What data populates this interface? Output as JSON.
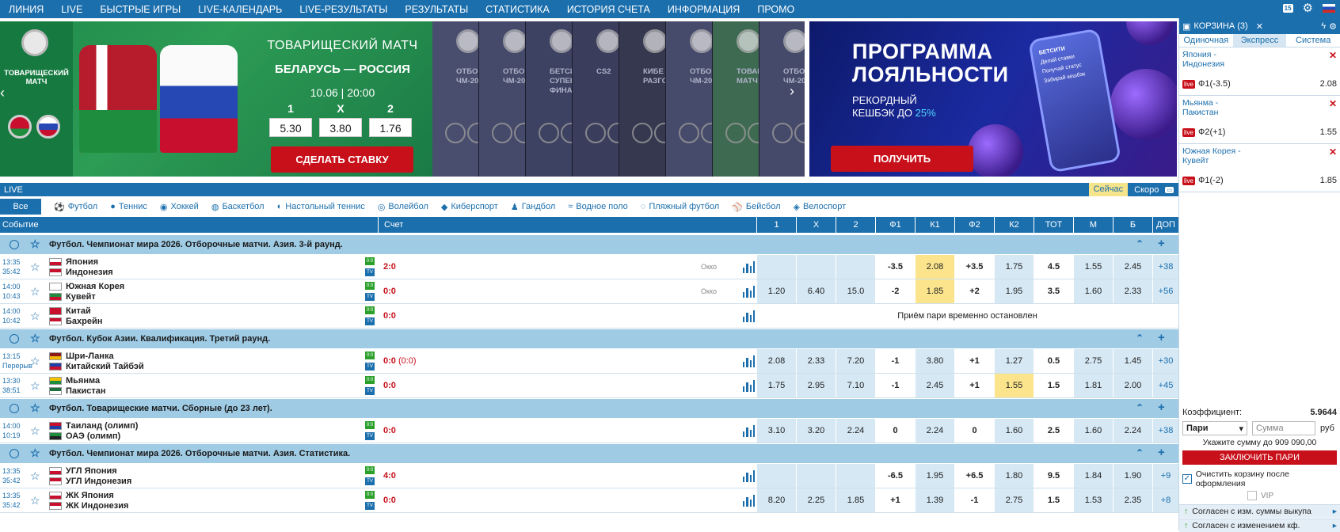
{
  "topnav": {
    "items": [
      "ЛИНИЯ",
      "LIVE",
      "БЫСТРЫЕ ИГРЫ",
      "LIVE-КАЛЕНДАРЬ",
      "LIVE-РЕЗУЛЬТАТЫ",
      "РЕЗУЛЬТАТЫ",
      "СТАТИСТИКА",
      "ИСТОРИЯ СЧЕТА",
      "ИНФОРМАЦИЯ",
      "ПРОМО"
    ],
    "age_badge": "15"
  },
  "main_banner": {
    "left_title": "ТОВАРИЩЕСКИЙ МАТЧ",
    "title": "ТОВАРИЩЕСКИЙ МАТЧ",
    "match": "БЕЛАРУСЬ — РОССИЯ",
    "datetime": "10.06 | 20:00",
    "odds": [
      {
        "label": "1",
        "value": "5.30"
      },
      {
        "label": "X",
        "value": "3.80"
      },
      {
        "label": "2",
        "value": "1.76"
      }
    ],
    "button": "СДЕЛАТЬ СТАВКУ"
  },
  "thumbs": [
    {
      "text": "ОТБО\nЧМ-20"
    },
    {
      "text": "ОТБО\nЧМ-20"
    },
    {
      "text": "БЕТСИ\nСУПЕРЛ\nФИНА"
    },
    {
      "text": "CS2"
    },
    {
      "text": "КИБЕ\nРАЗГО"
    },
    {
      "text": "ОТБО\nЧМ-20"
    },
    {
      "text": "ТОВАР\nМАТЧ"
    },
    {
      "text": "ОТБО\nЧМ-20"
    }
  ],
  "loyalty": {
    "title_1": "ПРОГРАММА",
    "title_2": "ЛОЯЛЬНОСТИ",
    "sub_1": "РЕКОРДНЫЙ",
    "sub_2": "КЕШБЭК ДО",
    "sub_highlight": "25%",
    "phone_brand": "БЕТСИТИ",
    "phone_lines": [
      "Делай ставки",
      "Получай статус",
      "Забирай кешбэк"
    ],
    "button": "ПОЛУЧИТЬ"
  },
  "livebar": {
    "title": "LIVE",
    "now": "Сейчас",
    "soon": "Скоро"
  },
  "sports": {
    "all": "Все",
    "items": [
      {
        "label": "Футбол",
        "icon": "⚽"
      },
      {
        "label": "Теннис",
        "icon": "●"
      },
      {
        "label": "Хоккей",
        "icon": "◉"
      },
      {
        "label": "Баскетбол",
        "icon": "◍"
      },
      {
        "label": "Настольный теннис",
        "icon": "◐"
      },
      {
        "label": "Волейбол",
        "icon": "◎"
      },
      {
        "label": "Киберспорт",
        "icon": "◆"
      },
      {
        "label": "Гандбол",
        "icon": "♟"
      },
      {
        "label": "Водное поло",
        "icon": "≈"
      },
      {
        "label": "Пляжный футбол",
        "icon": "◌"
      },
      {
        "label": "Бейсбол",
        "icon": "⚾"
      },
      {
        "label": "Велоспорт",
        "icon": "◈"
      }
    ]
  },
  "table": {
    "header": {
      "event": "Событие",
      "score": "Счет",
      "cols": [
        "1",
        "X",
        "2",
        "Ф1",
        "К1",
        "Ф2",
        "К2",
        "ТОТ",
        "М",
        "Б",
        "ДОП"
      ]
    },
    "groups": [
      {
        "name": "Футбол. Чемпионат мира 2026. Отборочные матчи. Азия. 3-й раунд.",
        "matches": [
          {
            "time": "13:35",
            "clock": "35:42",
            "home": "Япония",
            "away": "Индонезия",
            "score": "2:0",
            "score_extra": "",
            "okko": "Окко",
            "odds": [
              "",
              "",
              "",
              "-3.5",
              "2.08",
              "+3.5",
              "1.75",
              "4.5",
              "1.55",
              "2.45",
              "+38"
            ]
          },
          {
            "time": "14:00",
            "clock": "10:43",
            "home": "Южная Корея",
            "away": "Кувейт",
            "score": "0:0",
            "score_extra": "",
            "okko": "Окко",
            "odds": [
              "1.20",
              "6.40",
              "15.0",
              "-2",
              "1.85",
              "+2",
              "1.95",
              "3.5",
              "1.60",
              "2.33",
              "+56"
            ]
          },
          {
            "time": "14:00",
            "clock": "10:42",
            "home": "Китай",
            "away": "Бахрейн",
            "score": "0:0",
            "score_extra": "",
            "okko": "",
            "suspended": "Приём пари временно остановлен"
          }
        ]
      },
      {
        "name": "Футбол. Кубок Азии. Квалификация. Третий раунд.",
        "matches": [
          {
            "time": "13:15",
            "clock": "Перерыв",
            "home": "Шри-Ланка",
            "away": "Китайский Тайбэй",
            "score": "0:0",
            "score_extra": "(0:0)",
            "okko": "",
            "odds": [
              "2.08",
              "2.33",
              "7.20",
              "-1",
              "3.80",
              "+1",
              "1.27",
              "0.5",
              "2.75",
              "1.45",
              "+30"
            ]
          },
          {
            "time": "13:30",
            "clock": "38:51",
            "home": "Мьянма",
            "away": "Пакистан",
            "score": "0:0",
            "score_extra": "",
            "okko": "",
            "odds": [
              "1.75",
              "2.95",
              "7.10",
              "-1",
              "2.45",
              "+1",
              "1.55",
              "1.5",
              "1.81",
              "2.00",
              "+45"
            ]
          }
        ]
      },
      {
        "name": "Футбол. Товарищеские матчи. Сборные (до 23 лет).",
        "matches": [
          {
            "time": "14:00",
            "clock": "10:19",
            "home": "Таиланд (олимп)",
            "away": "ОАЭ (олимп)",
            "score": "0:0",
            "score_extra": "",
            "okko": "",
            "odds": [
              "3.10",
              "3.20",
              "2.24",
              "0",
              "2.24",
              "0",
              "1.60",
              "2.5",
              "1.60",
              "2.24",
              "+38"
            ]
          }
        ]
      },
      {
        "name": "Футбол. Чемпионат мира 2026. Отборочные матчи. Азия. Статистика.",
        "matches": [
          {
            "time": "13:35",
            "clock": "35:42",
            "home": "УГЛ Япония",
            "away": "УГЛ Индонезия",
            "score": "4:0",
            "score_extra": "",
            "okko": "",
            "odds": [
              "",
              "",
              "",
              "-6.5",
              "1.95",
              "+6.5",
              "1.80",
              "9.5",
              "1.84",
              "1.90",
              "+9"
            ]
          },
          {
            "time": "13:35",
            "clock": "35:42",
            "home": "ЖК Япония",
            "away": "ЖК Индонезия",
            "score": "0:0",
            "score_extra": "",
            "okko": "",
            "odds": [
              "8.20",
              "2.25",
              "1.85",
              "+1",
              "1.39",
              "-1",
              "2.75",
              "1.5",
              "1.53",
              "2.35",
              "+8"
            ]
          }
        ]
      }
    ]
  },
  "basket": {
    "title": "КОРЗИНА (3)",
    "tabs": [
      "Одиночная",
      "Экспресс",
      "Система"
    ],
    "bets": [
      {
        "line1": "Япония -",
        "line2": "Индонезия",
        "live": "live",
        "outcome": "Ф1(-3.5)",
        "coef": "2.08"
      },
      {
        "line1": "Мьянма -",
        "line2": "Пакистан",
        "live": "live",
        "outcome": "Ф2(+1)",
        "coef": "1.55"
      },
      {
        "line1": "Южная Корея -",
        "line2": "Кувейт",
        "live": "live",
        "outcome": "Ф1(-2)",
        "coef": "1.85"
      }
    ],
    "coef_label": "Коэффициент:",
    "coef_value": "5.9644",
    "type_value": "Пари",
    "sum_placeholder": "Сумма",
    "currency": "руб",
    "hint": "Укажите сумму до 909 090,00",
    "submit": "ЗАКЛЮЧИТЬ ПАРИ",
    "clear_label": "Очистить корзину после оформления",
    "vip_label": "VIP",
    "agree_1": "Согласен с изм. суммы выкупа",
    "agree_2": "Согласен с изменением кф."
  },
  "colors": {
    "brand": "#1c6fad",
    "accent": "#c8101a",
    "highlight": "#fbe48c",
    "league_bg": "#9fcbe4"
  }
}
